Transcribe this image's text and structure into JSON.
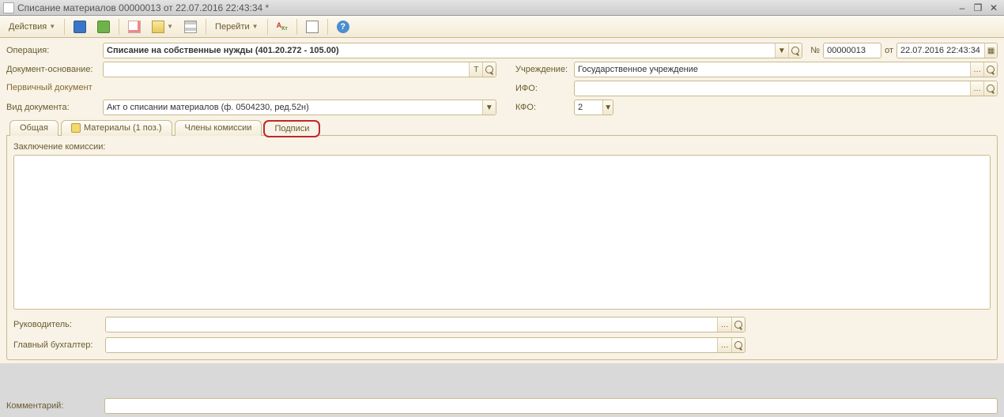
{
  "titlebar": {
    "title": "Списание материалов 00000013 от 22.07.2016 22:43:34 *"
  },
  "toolbar": {
    "actions": "Действия",
    "goto": "Перейти"
  },
  "labels": {
    "operation": "Операция:",
    "doc_basis": "Документ-основание:",
    "primary_doc": "Первичный документ",
    "doc_type": "Вид документа:",
    "institution": "Учреждение:",
    "ifo": "ИФО:",
    "kfo": "КФО:",
    "number": "№",
    "from": "от",
    "conclusion": "Заключение комиссии:",
    "head": "Руководитель:",
    "chief_acc": "Главный бухгалтер:",
    "comment": "Комментарий:"
  },
  "fields": {
    "operation": "Списание на собственные нужды (401.20.272 - 105.00)",
    "doc_basis": "",
    "doc_type": "Акт о списании материалов (ф. 0504230, ред.52н)",
    "institution": "Государственное учреждение",
    "ifo": "",
    "kfo": "2",
    "number": "00000013",
    "date": "22.07.2016 22:43:34",
    "conclusion": "",
    "head": "",
    "chief_acc": "",
    "comment": ""
  },
  "tabs": {
    "general": "Общая",
    "materials": "Материалы (1 поз.)",
    "commission": "Члены комиссии",
    "signatures": "Подписи"
  }
}
